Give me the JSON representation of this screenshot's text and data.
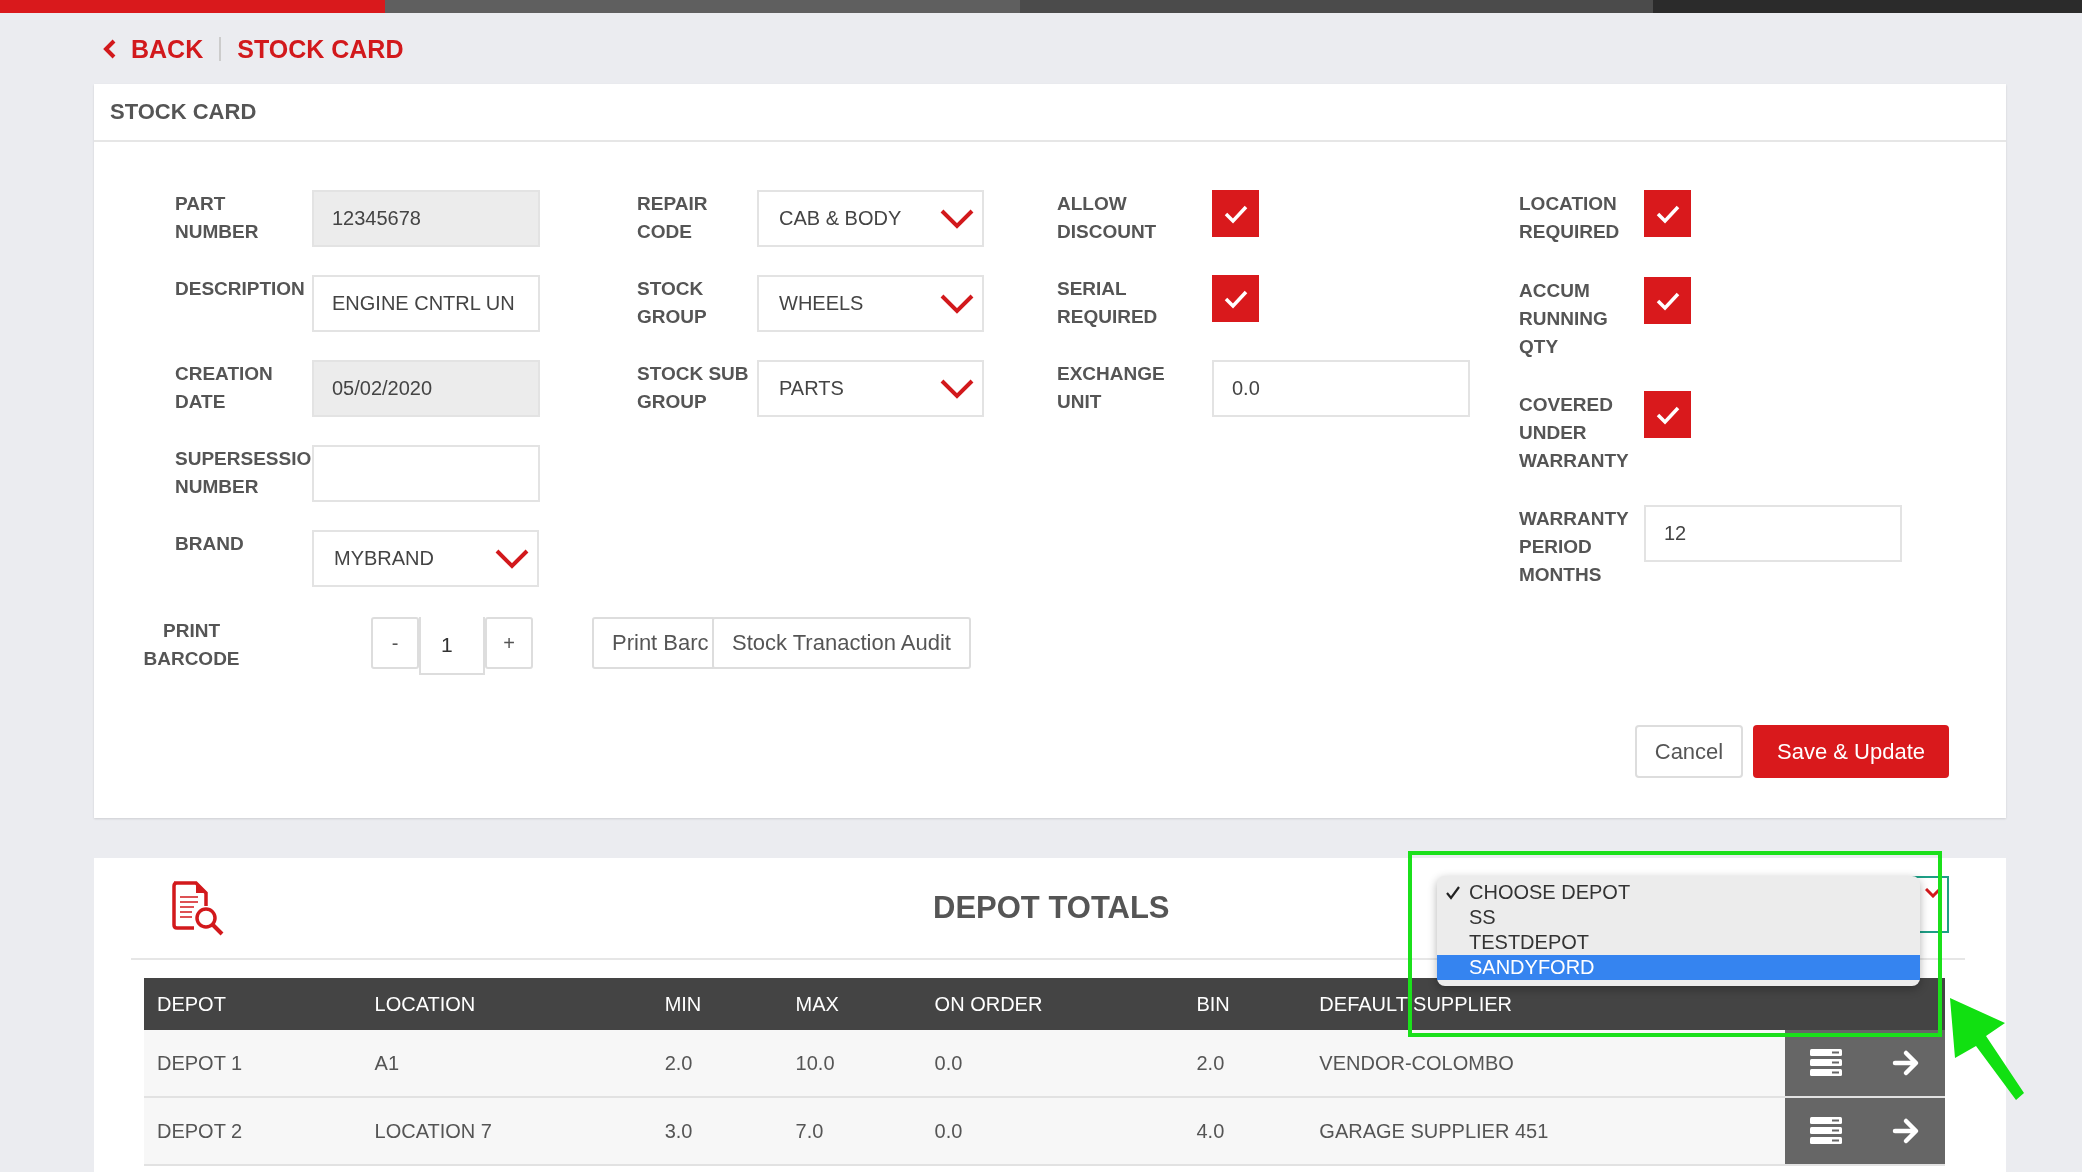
{
  "progress": {
    "level": 0.185
  },
  "breadcrumb": {
    "back": "BACK",
    "current": "STOCK CARD"
  },
  "card": {
    "title": "STOCK CARD"
  },
  "columns": [
    [
      {
        "kind": "text",
        "label": "PART NUMBER",
        "value": "12345678",
        "disabled": true
      },
      {
        "kind": "text",
        "label": "DESCRIPTION",
        "value": "ENGINE CNTRL UN",
        "disabled": false
      },
      {
        "kind": "text",
        "label": "CREATION DATE",
        "value": "05/02/2020",
        "disabled": true
      },
      {
        "kind": "text",
        "label": "SUPERSESSIO NUMBER",
        "disabled": false
      },
      {
        "kind": "select",
        "label": "BRAND",
        "value": "MYBRAND"
      }
    ],
    [
      {
        "kind": "select",
        "label": "REPAIR CODE",
        "value": "CAB & BODY"
      },
      {
        "kind": "select",
        "label": "STOCK GROUP",
        "value": "WHEELS"
      },
      {
        "kind": "select",
        "label": "STOCK SUB GROUP",
        "value": "PARTS"
      }
    ],
    [
      {
        "kind": "checkbox",
        "label": "ALLOW DISCOUNT",
        "checked": true
      },
      {
        "kind": "checkbox",
        "label": "SERIAL REQUIRED",
        "checked": true
      },
      {
        "kind": "text",
        "label": "EXCHANGE UNIT",
        "value": "0.0",
        "disabled": false
      }
    ],
    [
      {
        "kind": "checkbox",
        "label": "LOCATION REQUIRED",
        "checked": true
      },
      {
        "kind": "checkbox",
        "label": "ACCUM RUNNING QTY",
        "checked": true
      },
      {
        "kind": "checkbox",
        "label": "COVERED UNDER WARRANTY",
        "checked": true
      },
      {
        "kind": "text",
        "label": "WARRANTY PERIOD MONTHS",
        "value": "12",
        "disabled": false
      }
    ]
  ],
  "print_barcode": {
    "label": "PRINT BARCODE",
    "decrement": "-",
    "quantity": "1",
    "increment": "+"
  },
  "actions": [
    "Print Barc",
    "Stock Tranaction Audit"
  ],
  "buttons": {
    "cancel": "Cancel",
    "save": "Save & Update"
  },
  "depot_totals": {
    "title": "DEPOT TOTALS",
    "columns": [
      "DEPOT",
      "LOCATION",
      "MIN",
      "MAX",
      "ON ORDER",
      "BIN",
      "DEFAULT SUPPLIER"
    ],
    "rows": [
      [
        "DEPOT 1",
        "A1",
        "2.0",
        "10.0",
        "0.0",
        "2.0",
        "VENDOR-COLOMBO"
      ],
      [
        "DEPOT 2",
        "LOCATION 7",
        "3.0",
        "7.0",
        "0.0",
        "4.0",
        "GARAGE SUPPLIER 451"
      ]
    ]
  },
  "depot_dropdown": {
    "options": [
      {
        "label": "CHOOSE DEPOT",
        "selected": true,
        "highlighted": false
      },
      {
        "label": "SS",
        "selected": false,
        "highlighted": false
      },
      {
        "label": "TESTDEPOT",
        "selected": false,
        "highlighted": false
      },
      {
        "label": "SANDYFORD",
        "selected": false,
        "highlighted": true
      }
    ]
  }
}
